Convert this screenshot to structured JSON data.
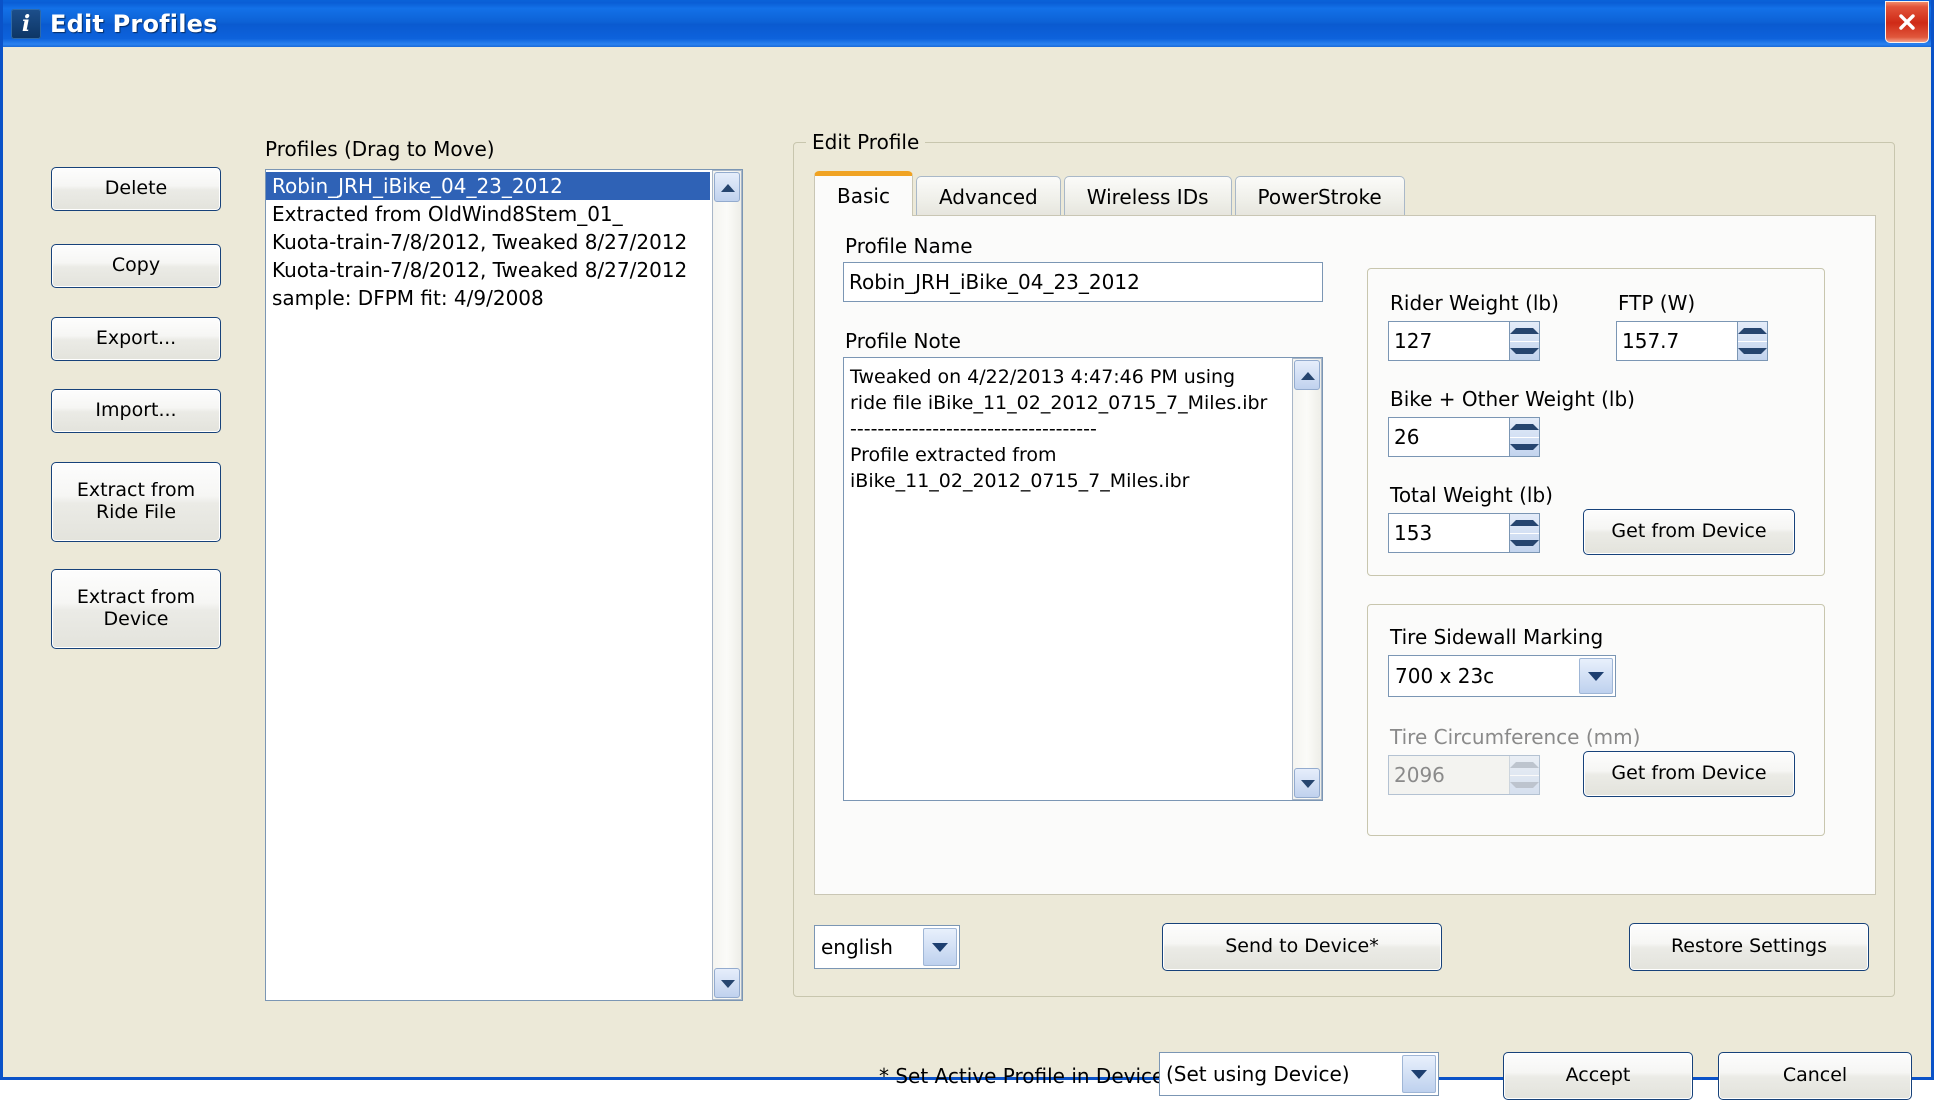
{
  "window": {
    "title": "Edit Profiles",
    "app_icon": "i",
    "close_icon": "close-icon",
    "titlebar_color": "#0a5ed6",
    "close_color": "#cf2a16",
    "client_color": "#ece9d8"
  },
  "left_buttons": [
    {
      "label": "Delete",
      "name": "delete-button"
    },
    {
      "label": "Copy",
      "name": "copy-button"
    },
    {
      "label": "Export...",
      "name": "export-button"
    },
    {
      "label": "Import...",
      "name": "import-button"
    },
    {
      "label": "Extract from\nRide File",
      "name": "extract-from-ride-file-button"
    },
    {
      "label": "Extract from\nDevice",
      "name": "extract-from-device-button"
    }
  ],
  "profiles": {
    "label": "Profiles (Drag to Move)",
    "selected_index": 0,
    "items": [
      "Robin_JRH_iBike_04_23_2012",
      "Extracted from OldWind8Stem_01_",
      "Kuota-train-7/8/2012, Tweaked 8/27/2012",
      "Kuota-train-7/8/2012, Tweaked 8/27/2012",
      "sample: DFPM fit: 4/9/2008"
    ],
    "scroll_up_icon": "chevron-up-icon",
    "scroll_down_icon": "chevron-down-icon"
  },
  "edit_profile": {
    "legend": "Edit Profile",
    "tabs": [
      {
        "label": "Basic",
        "active": true
      },
      {
        "label": "Advanced",
        "active": false
      },
      {
        "label": "Wireless IDs",
        "active": false
      },
      {
        "label": "PowerStroke",
        "active": false
      }
    ],
    "active_tab_accent": "#f0a323",
    "basic": {
      "profile_name_label": "Profile Name",
      "profile_name_value": "Robin_JRH_iBike_04_23_2012",
      "profile_note_label": "Profile Note",
      "profile_note_value": "Tweaked on 4/22/2013 4:47:46 PM using\nride file iBike_11_02_2012_0715_7_Miles.ibr\n------------------------------------\nProfile extracted from\niBike_11_02_2012_0715_7_Miles.ibr",
      "note_scroll_up_icon": "chevron-up-icon",
      "note_scroll_down_icon": "chevron-down-icon",
      "weights": {
        "rider_weight_label": "Rider Weight (lb)",
        "rider_weight_value": "127",
        "ftp_label": "FTP (W)",
        "ftp_value": "157.7",
        "bike_other_weight_label": "Bike + Other Weight (lb)",
        "bike_other_weight_value": "26",
        "total_weight_label": "Total Weight (lb)",
        "total_weight_value": "153",
        "get_from_device_label": "Get from Device"
      },
      "tire": {
        "sidewall_label": "Tire Sidewall Marking",
        "sidewall_value": "700 x 23c",
        "circumference_label": "Tire Circumference (mm)",
        "circumference_value": "2096",
        "circumference_disabled": true,
        "get_from_device_label": "Get from Device"
      }
    },
    "units_value": "english",
    "send_to_device_label": "Send to Device*",
    "restore_settings_label": "Restore Settings"
  },
  "bottom": {
    "set_active_label": "* Set Active Profile in Device",
    "set_active_value": "(Set using Device)",
    "accept_label": "Accept",
    "cancel_label": "Cancel"
  }
}
